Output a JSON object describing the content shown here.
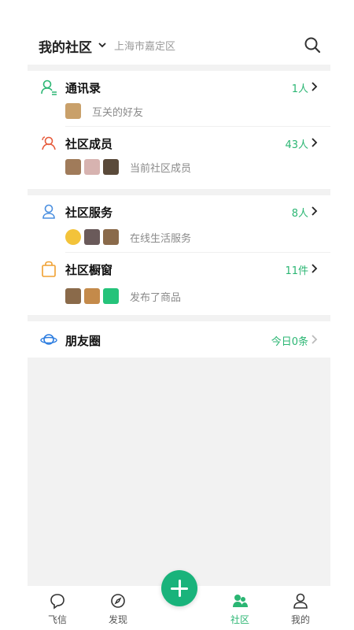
{
  "header": {
    "title": "我的社区",
    "location": "上海市嘉定区"
  },
  "sections": [
    {
      "rows": [
        {
          "title": "通讯录",
          "count": "1人",
          "subtitle": "互关的好友",
          "avatar_colors": [
            "#c9a06a"
          ]
        },
        {
          "title": "社区成员",
          "count": "43人",
          "subtitle": "当前社区成员",
          "avatar_colors": [
            "#a07b5a",
            "#d7b3b0",
            "#5a4a3a"
          ]
        }
      ]
    },
    {
      "rows": [
        {
          "title": "社区服务",
          "count": "8人",
          "subtitle": "在线生活服务",
          "avatar_colors": [
            "#f3c33a",
            "#6a5a5a",
            "#8a6a4a"
          ]
        },
        {
          "title": "社区橱窗",
          "count": "11件",
          "subtitle": "发布了商品",
          "avatar_colors": [
            "#8a6a4a",
            "#c48a4a",
            "#25c37a"
          ]
        }
      ]
    },
    {
      "rows": [
        {
          "title": "朋友圈",
          "count": "今日0条"
        }
      ]
    }
  ],
  "tabbar": {
    "tabs": [
      {
        "label": "飞信"
      },
      {
        "label": "发现"
      },
      {
        "label": "社区"
      },
      {
        "label": "我的"
      }
    ]
  },
  "colors": {
    "accent": "#2bb673",
    "fab": "#19b37b",
    "separator": "#f2f2f2",
    "contacts_icon": "#2bb673",
    "members_icon": "#e65a3a",
    "service_icon": "#4a8fe0",
    "showcase_icon": "#f0a030",
    "moments_icon": "#2d7de0"
  },
  "icons": {
    "search": "search-icon",
    "contacts": "contacts-icon",
    "members": "members-icon",
    "service": "service-icon",
    "showcase": "shopping-bag-icon",
    "moments": "planet-icon"
  }
}
